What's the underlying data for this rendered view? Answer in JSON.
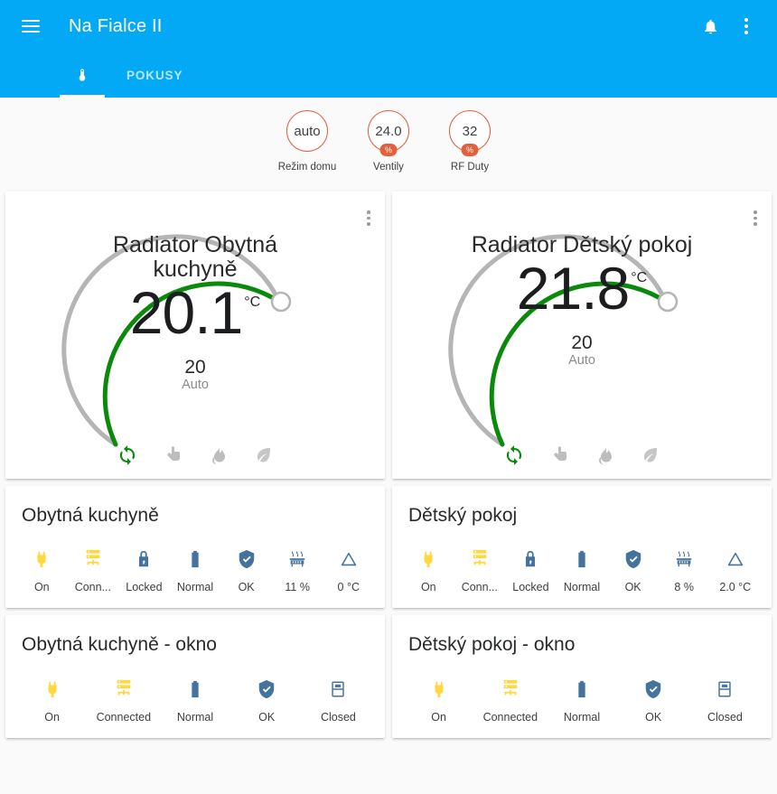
{
  "appbar": {
    "menu_icon": "hamburger-icon",
    "title": "Na Fialce II",
    "notifications_icon": "bell-icon",
    "overflow_icon": "more-vertical-icon"
  },
  "tabs": [
    {
      "icon": "thermometer-icon",
      "label": "",
      "active": true
    },
    {
      "icon": "",
      "label": "POKUSY",
      "active": false
    }
  ],
  "colors": {
    "appbar": "#03a9f4",
    "badge_accent": "#e4603c",
    "icon_active": "#ffd740",
    "icon_inactive": "#44739e",
    "dial_active": "#0a8a0a",
    "dial_track": "#b5b5b5",
    "background": "#fafafa"
  },
  "badges": [
    {
      "value": "auto",
      "sub": "",
      "label": "Režim domu"
    },
    {
      "value": "24.0",
      "sub": "%",
      "label": "Ventily"
    },
    {
      "value": "32",
      "sub": "%",
      "label": "RF Duty"
    }
  ],
  "thermostats": [
    {
      "name": "Radiator Obytná kuchyně",
      "current_temp": "20.1",
      "unit": "°C",
      "setpoint": "20",
      "mode": "Auto",
      "modes": [
        {
          "icon": "auto-repeat-icon",
          "active": true
        },
        {
          "icon": "hand-pointing-icon",
          "active": false
        },
        {
          "icon": "fire-icon",
          "active": false
        },
        {
          "icon": "leaf-icon",
          "active": false
        }
      ]
    },
    {
      "name": "Radiator Dětský pokoj",
      "current_temp": "21.8",
      "unit": "°C",
      "setpoint": "20",
      "mode": "Auto",
      "modes": [
        {
          "icon": "auto-repeat-icon",
          "active": true
        },
        {
          "icon": "hand-pointing-icon",
          "active": false
        },
        {
          "icon": "fire-icon",
          "active": false
        },
        {
          "icon": "leaf-icon",
          "active": false
        }
      ]
    }
  ],
  "glance_cards": [
    {
      "title": "Obytná kuchyně",
      "items": [
        {
          "icon": "power-plug-icon",
          "label": "On",
          "state": "active"
        },
        {
          "icon": "server-network-icon",
          "label": "Conn...",
          "state": "active"
        },
        {
          "icon": "lock-icon",
          "label": "Locked",
          "state": "inactive"
        },
        {
          "icon": "battery-icon",
          "label": "Normal",
          "state": "inactive"
        },
        {
          "icon": "shield-check-icon",
          "label": "OK",
          "state": "inactive"
        },
        {
          "icon": "radiator-icon",
          "label": "11 %",
          "state": "inactive"
        },
        {
          "icon": "delta-icon",
          "label": "0 °C",
          "state": "inactive"
        }
      ]
    },
    {
      "title": "Dětský pokoj",
      "items": [
        {
          "icon": "power-plug-icon",
          "label": "On",
          "state": "active"
        },
        {
          "icon": "server-network-icon",
          "label": "Conn...",
          "state": "active"
        },
        {
          "icon": "lock-icon",
          "label": "Locked",
          "state": "inactive"
        },
        {
          "icon": "battery-icon",
          "label": "Normal",
          "state": "inactive"
        },
        {
          "icon": "shield-check-icon",
          "label": "OK",
          "state": "inactive"
        },
        {
          "icon": "radiator-icon",
          "label": "8 %",
          "state": "inactive"
        },
        {
          "icon": "delta-icon",
          "label": "2.0 °C",
          "state": "inactive"
        }
      ]
    },
    {
      "title": "Obytná kuchyně - okno",
      "items": [
        {
          "icon": "power-plug-icon",
          "label": "On",
          "state": "active"
        },
        {
          "icon": "server-network-icon",
          "label": "Connected",
          "state": "active"
        },
        {
          "icon": "battery-icon",
          "label": "Normal",
          "state": "inactive"
        },
        {
          "icon": "shield-check-icon",
          "label": "OK",
          "state": "inactive"
        },
        {
          "icon": "window-closed-icon",
          "label": "Closed",
          "state": "inactive"
        }
      ]
    },
    {
      "title": "Dětský pokoj - okno",
      "items": [
        {
          "icon": "power-plug-icon",
          "label": "On",
          "state": "active"
        },
        {
          "icon": "server-network-icon",
          "label": "Connected",
          "state": "active"
        },
        {
          "icon": "battery-icon",
          "label": "Normal",
          "state": "inactive"
        },
        {
          "icon": "shield-check-icon",
          "label": "OK",
          "state": "inactive"
        },
        {
          "icon": "window-closed-icon",
          "label": "Closed",
          "state": "inactive"
        }
      ]
    }
  ]
}
